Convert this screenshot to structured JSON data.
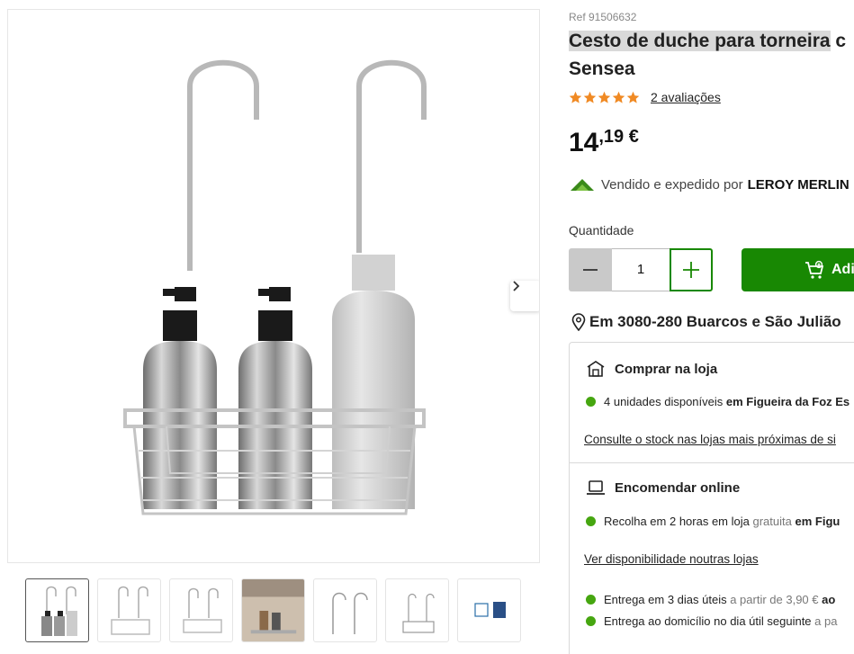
{
  "product": {
    "ref": "Ref 91506632",
    "title_highlight": "Cesto de duche para torneira",
    "title_rest": " c",
    "title_line2": "Sensea",
    "rating_stars": 5,
    "reviews": "2 avaliações",
    "price_int": "14",
    "price_dec": ",19 €",
    "seller_prefix": "Vendido e expedido por",
    "seller_name": "LEROY MERLIN"
  },
  "quantity": {
    "label": "Quantidade",
    "value": "1"
  },
  "cart": {
    "add_label": "Adi"
  },
  "location": {
    "text": "Em 3080-280 Buarcos e São Julião"
  },
  "store": {
    "heading": "Comprar na loja",
    "availability_prefix": "4 unidades disponíveis",
    "availability_store": "em Figueira da Foz Es",
    "stock_link": "Consulte o stock nas lojas mais próximas de si"
  },
  "online": {
    "heading": "Encomendar online",
    "pickup_prefix": "Recolha em 2 horas em loja",
    "pickup_free": "gratuita",
    "pickup_store": "em Figu",
    "availability_link": "Ver disponibilidade noutras lojas",
    "delivery1_prefix": "Entrega em 3 dias úteis",
    "delivery1_from": "a partir de 3,90 €",
    "delivery1_suffix": "ao",
    "delivery2_prefix": "Entrega ao domicílio no dia útil seguinte",
    "delivery2_from": "a pa"
  },
  "colors": {
    "brand_green": "#188803",
    "stock_green": "#46a610",
    "star_orange": "#f08a24"
  }
}
